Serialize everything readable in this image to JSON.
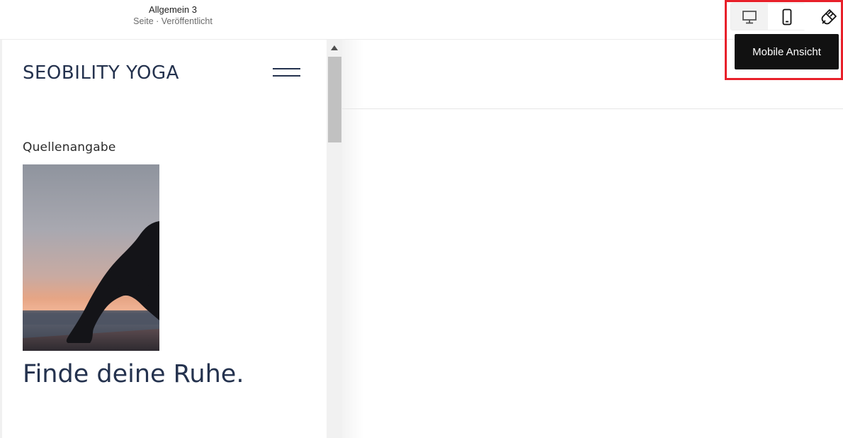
{
  "topbar": {
    "page_title": "Allgemein 3",
    "page_status": "Seite · Veröffentlicht",
    "view_toggle": {
      "desktop_icon": "desktop-monitor-icon",
      "mobile_icon": "mobile-phone-icon",
      "selected": "mobile"
    },
    "brush_icon": "paint-brush-icon",
    "tooltip": "Mobile Ansicht"
  },
  "highlight_color": "#e8202a",
  "preview": {
    "logo": "SEOBILITY YOGA",
    "menu_icon": "hamburger-menu-icon",
    "source_label": "Quellenangabe",
    "hero_image": "yoga-silhouette-sunset",
    "headline": "Finde deine Ruhe."
  },
  "colors": {
    "brand_text": "#24324e",
    "tooltip_bg": "#111111"
  }
}
